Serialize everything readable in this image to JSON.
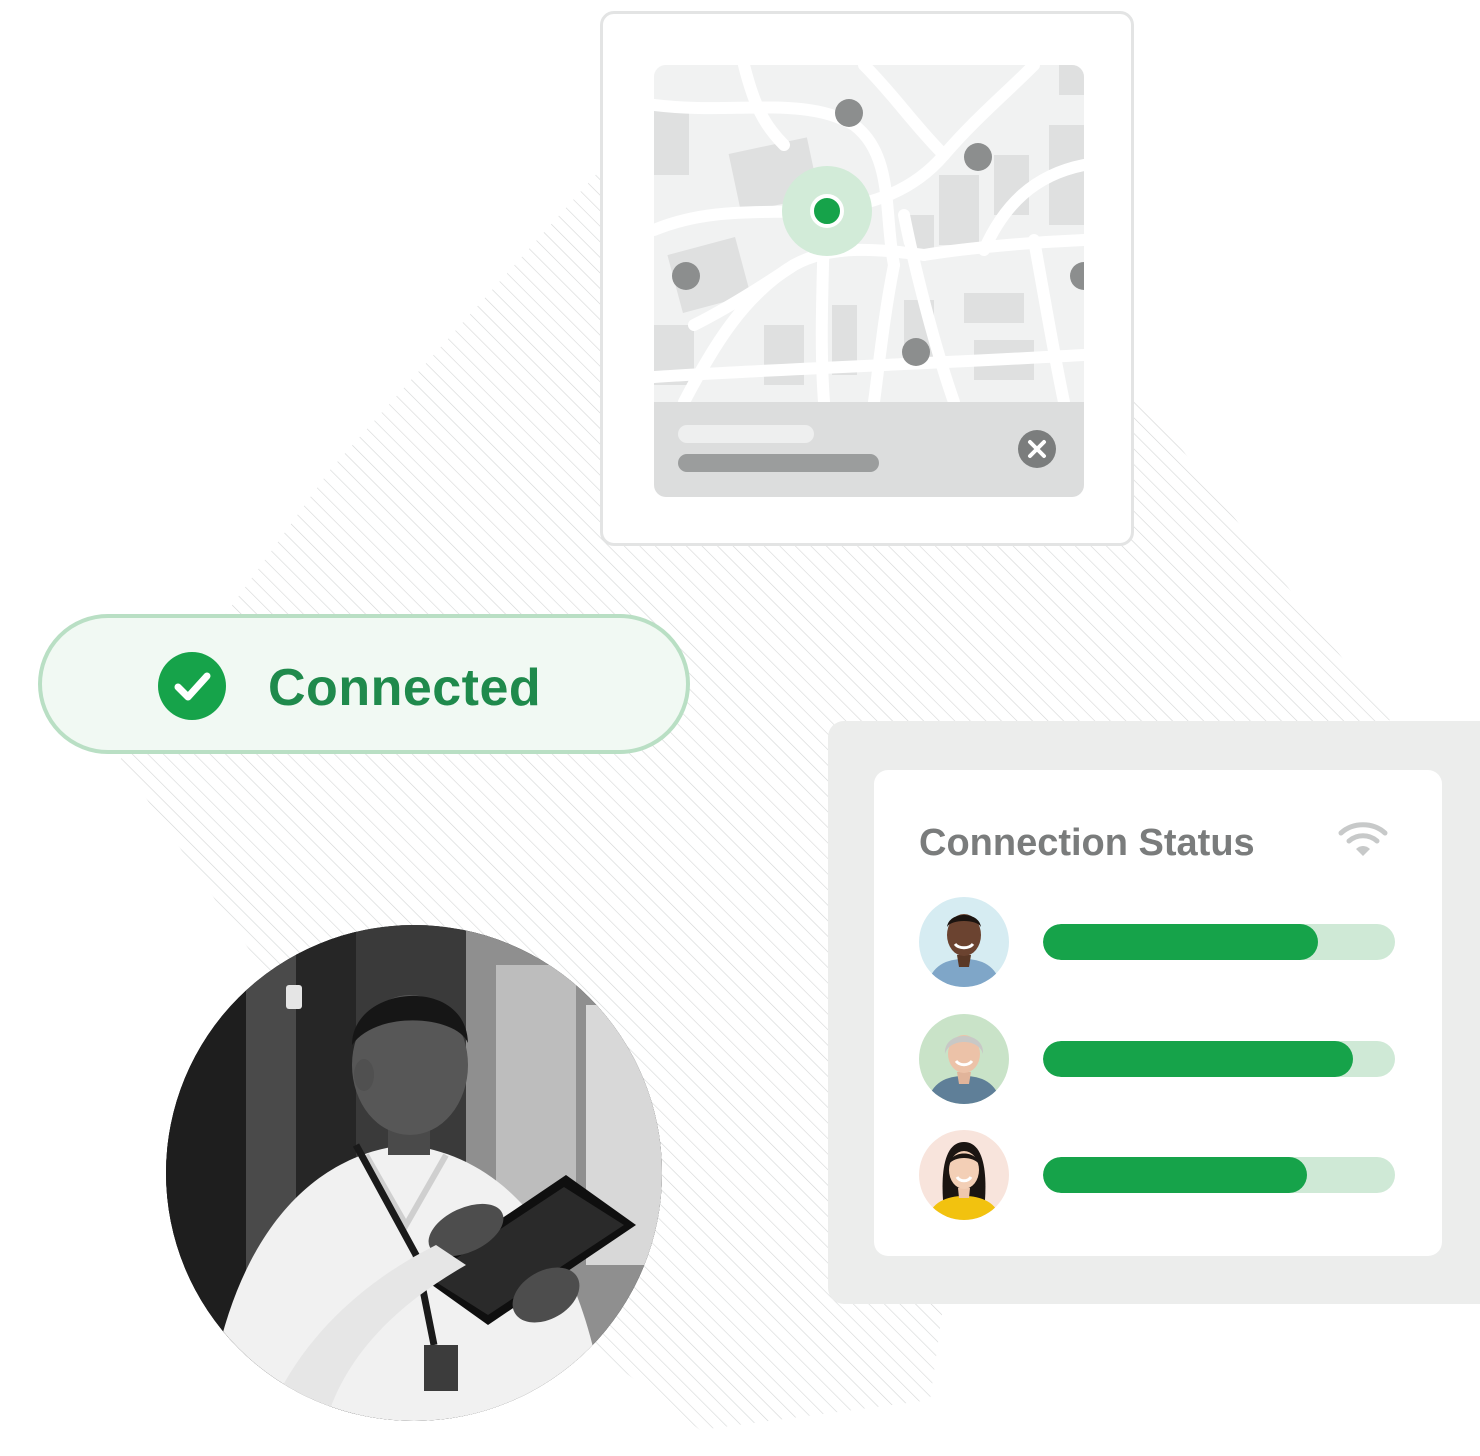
{
  "connection_badge": {
    "label": "Connected",
    "icon": "check-circle-icon",
    "accent_color": "#16a34a"
  },
  "map_card": {
    "close_icon": "close-icon",
    "pin_icon": "location-pin-icon"
  },
  "connection_status": {
    "title": "Connection Status",
    "icon": "wifi-icon",
    "users": [
      {
        "avatar": "avatar-man-smiling",
        "progress": 0.78
      },
      {
        "avatar": "avatar-woman-gray-hair",
        "progress": 0.88
      },
      {
        "avatar": "avatar-woman-yellow-shirt",
        "progress": 0.75
      }
    ]
  },
  "colors": {
    "brand_green": "#16a34a",
    "track_green": "#cfe9d6",
    "pill_bg": "#f1f9f3"
  }
}
